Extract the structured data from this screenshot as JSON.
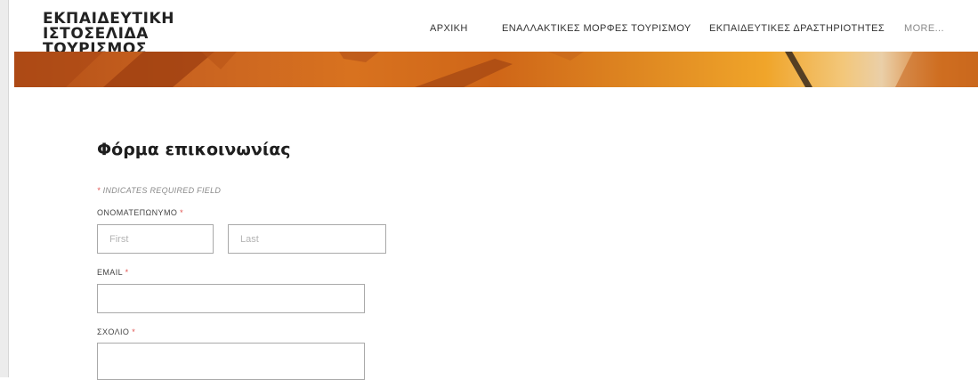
{
  "header": {
    "title_line1": "ΕΚΠΑΙΔΕΥΤΙΚΗ ΙΣΤΟΣΕΛΙΔΑ",
    "title_line2": "ΤΟΥΡΙΣΜΟΣ",
    "nav": [
      {
        "label": "ΑΡΧΙΚΗ"
      },
      {
        "label": "ΕΝΑΛΛΑΚΤΙΚΕΣ ΜΟΡΦΕΣ ΤΟΥΡΙΣΜΟΥ"
      },
      {
        "label": "ΕΚΠΑΙΔΕΥΤΙΚΕΣ ΔΡΑΣΤΗΡΙΟΤΗΤΕΣ"
      },
      {
        "label": "MORE..."
      }
    ]
  },
  "banner": {
    "colors": [
      "#b34f17",
      "#d8721f",
      "#f0a52a",
      "#eacfa8"
    ]
  },
  "form": {
    "title": "Φόρμα επικοινωνίας",
    "required_marker": "*",
    "required_note": "INDICATES REQUIRED FIELD",
    "name": {
      "label": "ΟΝΟΜΑΤΕΠΩΝΥΜΟ",
      "first_placeholder": "First",
      "last_placeholder": "Last"
    },
    "email": {
      "label": "EMAIL"
    },
    "comment": {
      "label": "ΣΧΟΛΙΟ"
    }
  },
  "colors": {
    "required_star": "#e0524f",
    "banner_accent": "#d8721f"
  }
}
